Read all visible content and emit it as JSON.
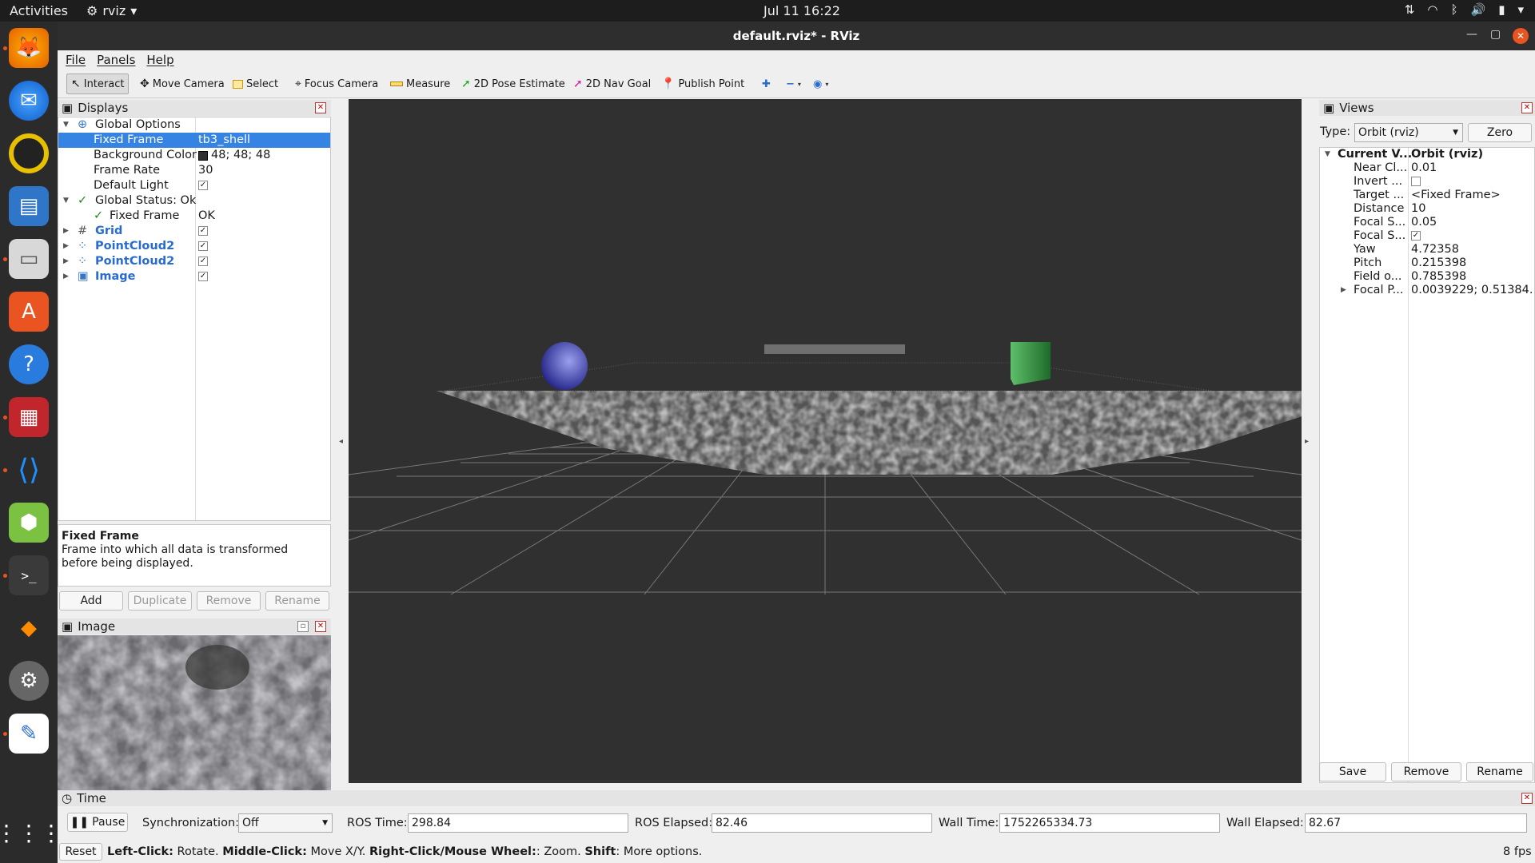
{
  "topbar": {
    "activities": "Activities",
    "app_name": "rviz",
    "clock": "Jul 11  16:22"
  },
  "window": {
    "title": "default.rviz* - RViz"
  },
  "menu": {
    "file": "File",
    "panels": "Panels",
    "help": "Help"
  },
  "toolbar": {
    "interact": "Interact",
    "move_camera": "Move Camera",
    "select": "Select",
    "focus_camera": "Focus Camera",
    "measure": "Measure",
    "pose_estimate": "2D Pose Estimate",
    "nav_goal": "2D Nav Goal",
    "publish_point": "Publish Point"
  },
  "displays": {
    "title": "Displays",
    "global_options": "Global Options",
    "fixed_frame_label": "Fixed Frame",
    "fixed_frame_value": "tb3_shell",
    "bg_label": "Background Color",
    "bg_value": "48; 48; 48",
    "frame_rate_label": "Frame Rate",
    "frame_rate_value": "30",
    "default_light_label": "Default Light",
    "global_status": "Global Status: Ok",
    "status_fixed_frame": "Fixed Frame",
    "status_fixed_frame_value": "OK",
    "grid": "Grid",
    "pc1": "PointCloud2",
    "pc2": "PointCloud2",
    "image": "Image",
    "desc_title": "Fixed Frame",
    "desc_text": "Frame into which all data is transformed before being displayed.",
    "add": "Add",
    "duplicate": "Duplicate",
    "remove": "Remove",
    "rename": "Rename"
  },
  "image_panel": {
    "title": "Image"
  },
  "views": {
    "title": "Views",
    "type_label": "Type:",
    "type_value": "Orbit (rviz)",
    "zero": "Zero",
    "current_view": "Current V...",
    "current_view_value": "Orbit (rviz)",
    "props": [
      {
        "name": "Near Cl...",
        "value": "0.01"
      },
      {
        "name": "Invert ...",
        "value": ""
      },
      {
        "name": "Target ...",
        "value": "<Fixed Frame>"
      },
      {
        "name": "Distance",
        "value": "10"
      },
      {
        "name": "Focal S...",
        "value": "0.05"
      },
      {
        "name": "Focal S...",
        "value": ""
      },
      {
        "name": "Yaw",
        "value": "4.72358"
      },
      {
        "name": "Pitch",
        "value": "0.215398"
      },
      {
        "name": "Field o...",
        "value": "0.785398"
      },
      {
        "name": "Focal P...",
        "value": "0.0039229; 0.51384..."
      }
    ],
    "save": "Save",
    "remove": "Remove",
    "rename": "Rename"
  },
  "time": {
    "title": "Time",
    "pause": "Pause",
    "sync_label": "Synchronization:",
    "sync_value": "Off",
    "ros_time_label": "ROS Time:",
    "ros_time": "298.84",
    "ros_elapsed_label": "ROS Elapsed:",
    "ros_elapsed": "82.46",
    "wall_time_label": "Wall Time:",
    "wall_time": "1752265334.73",
    "wall_elapsed_label": "Wall Elapsed:",
    "wall_elapsed": "82.67"
  },
  "status": {
    "reset": "Reset",
    "lc": "Left-Click:",
    "lc_t": " Rotate. ",
    "mc": "Middle-Click:",
    "mc_t": " Move X/Y. ",
    "rc": "Right-Click/Mouse Wheel:",
    "rc_t": ": Zoom. ",
    "sh": "Shift",
    "sh_t": ": More options.",
    "fps": "8 fps"
  },
  "colors": {
    "viewport_bg": "#303030",
    "selection": "#3584e4",
    "accent": "#e95420"
  }
}
